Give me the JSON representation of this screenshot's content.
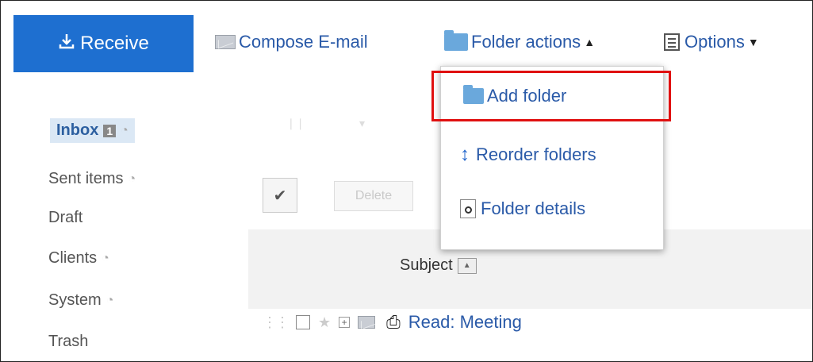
{
  "toolbar": {
    "receive_label": "Receive",
    "receive_icon": "download-icon",
    "compose_label": "Compose E-mail",
    "folder_actions_label": "Folder actions",
    "options_label": "Options"
  },
  "sidebar": {
    "items": [
      {
        "label": "Inbox",
        "badge": "1"
      },
      {
        "label": "Sent items"
      },
      {
        "label": "Draft"
      },
      {
        "label": "Clients"
      },
      {
        "label": "System"
      },
      {
        "label": "Trash"
      }
    ]
  },
  "dropdown": {
    "items": [
      {
        "label": "Add folder",
        "icon": "folder-icon"
      },
      {
        "label": "Reorder folders",
        "icon": "reorder-icon"
      },
      {
        "label": "Folder details",
        "icon": "magnifier-icon"
      }
    ]
  },
  "main": {
    "delete_label": "Delete",
    "subject_header": "Subject",
    "messages": [
      {
        "subject": "Read: Meeting"
      }
    ]
  },
  "colors": {
    "accent": "#1e6fd0",
    "link": "#2a5aa8",
    "highlight": "#e01010"
  }
}
